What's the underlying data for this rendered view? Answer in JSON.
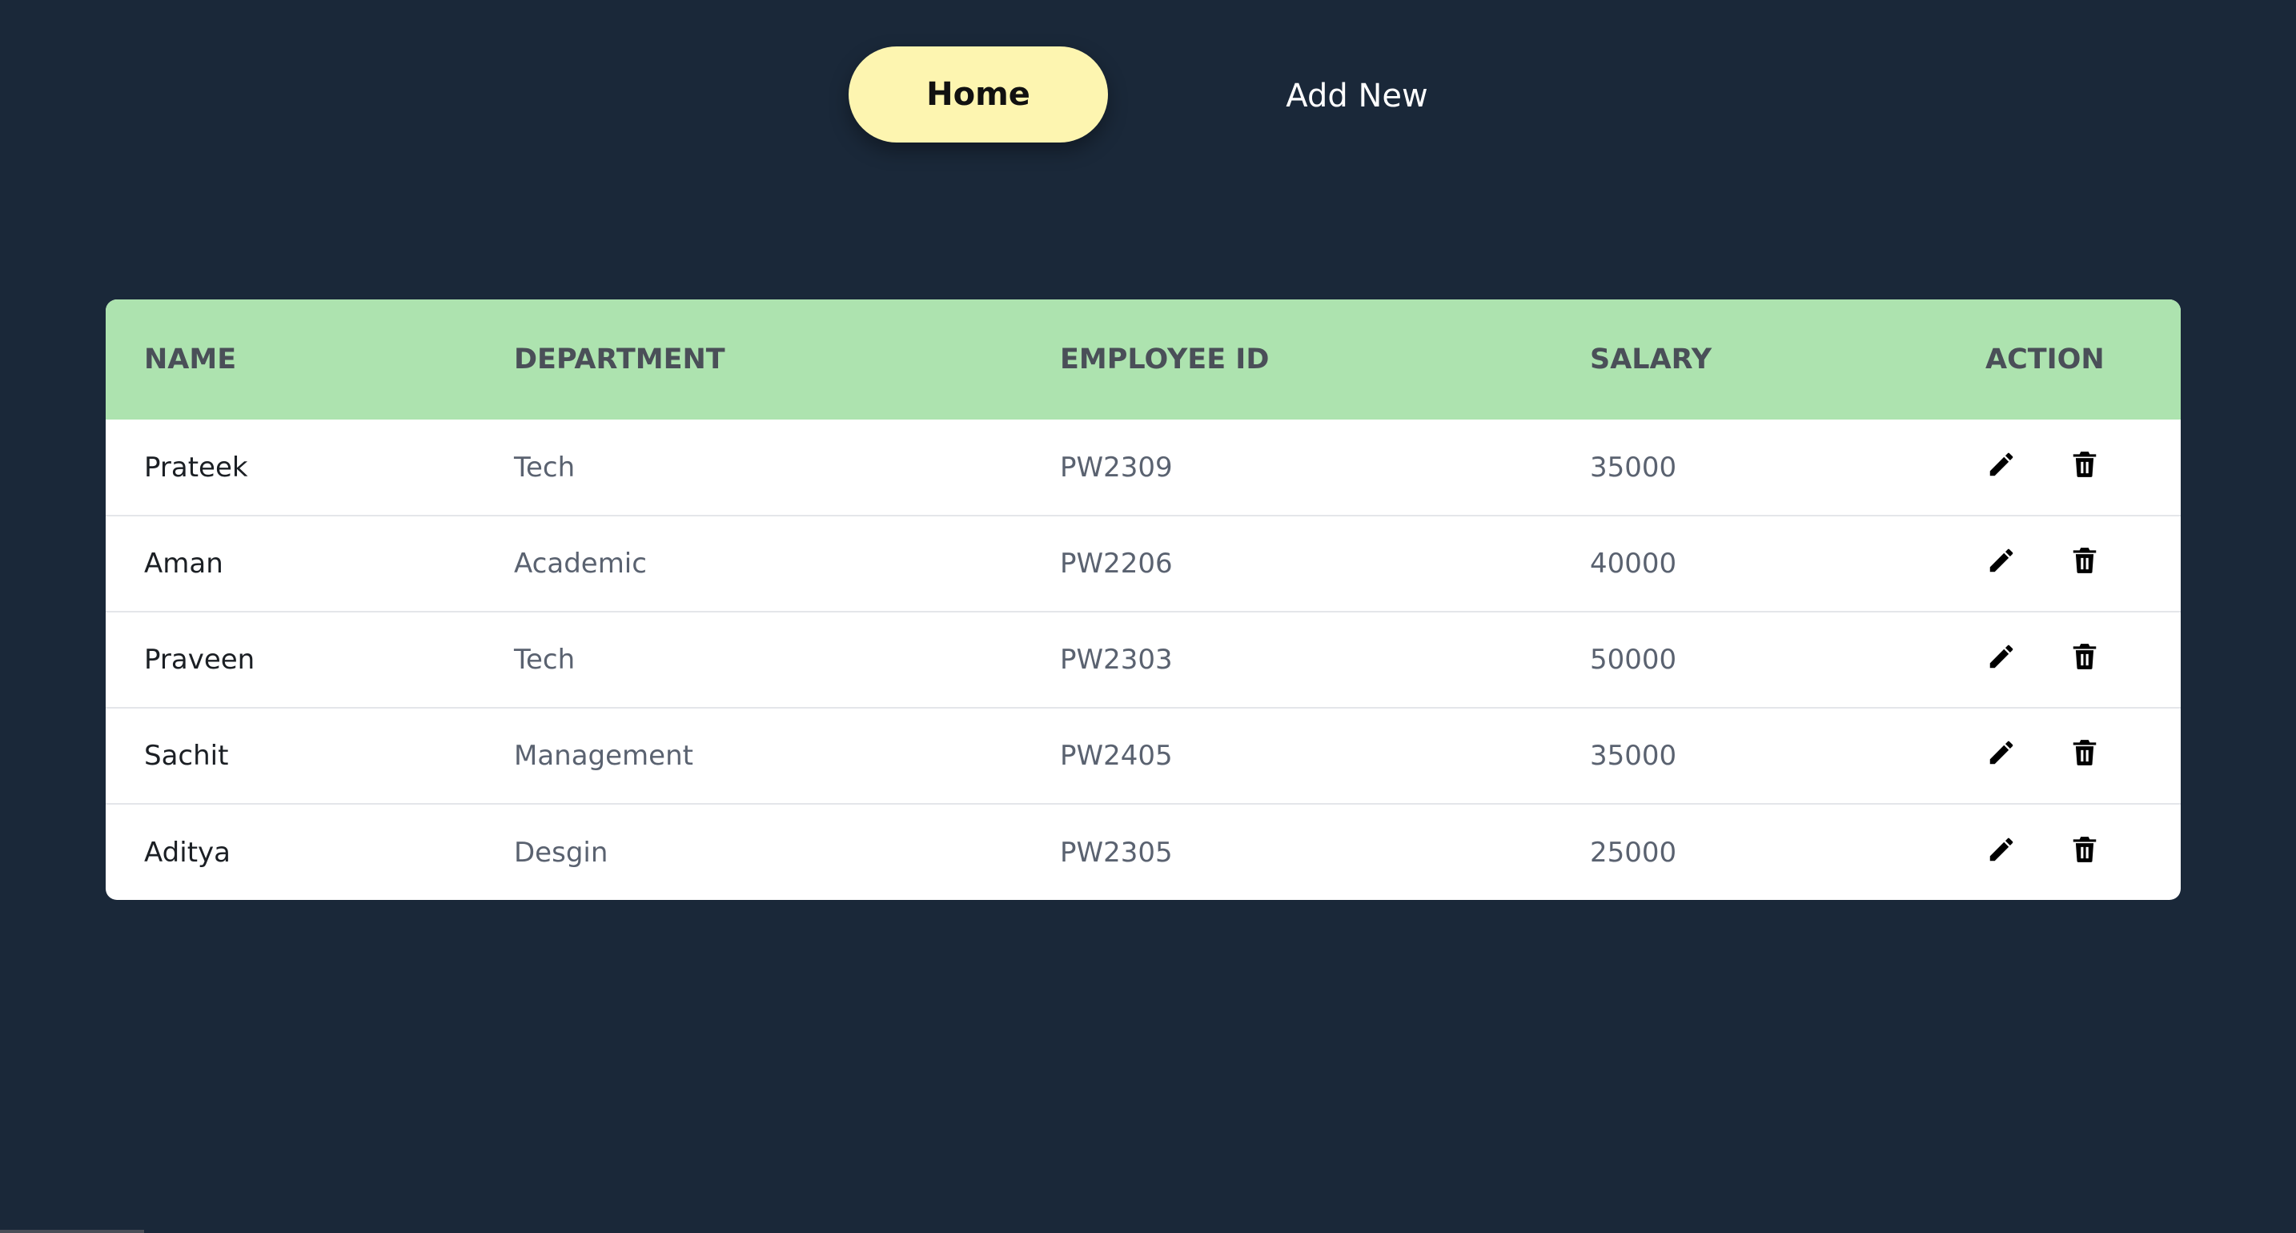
{
  "nav": {
    "home_label": "Home",
    "add_new_label": "Add New"
  },
  "table": {
    "headers": {
      "name": "NAME",
      "department": "DEPARTMENT",
      "employee_id": "EMPLOYEE ID",
      "salary": "SALARY",
      "action": "ACTION"
    },
    "rows": [
      {
        "name": "Prateek",
        "department": "Tech",
        "employee_id": "PW2309",
        "salary": "35000"
      },
      {
        "name": "Aman",
        "department": "Academic",
        "employee_id": "PW2206",
        "salary": "40000"
      },
      {
        "name": "Praveen",
        "department": "Tech",
        "employee_id": "PW2303",
        "salary": "50000"
      },
      {
        "name": "Sachit",
        "department": "Management",
        "employee_id": "PW2405",
        "salary": "35000"
      },
      {
        "name": "Aditya",
        "department": "Desgin",
        "employee_id": "PW2305",
        "salary": "25000"
      }
    ]
  },
  "icons": {
    "edit": "pencil-icon",
    "delete": "trash-icon"
  },
  "colors": {
    "background": "#1a2839",
    "nav_active": "#fdf5b0",
    "table_header": "#ade3af",
    "table_body": "#ffffff"
  }
}
